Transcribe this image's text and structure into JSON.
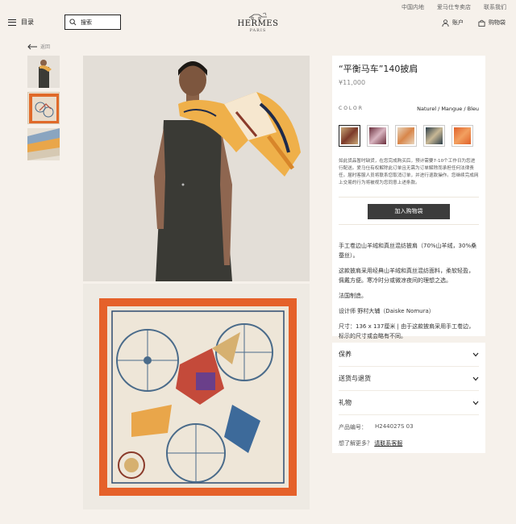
{
  "util": {
    "region": "中国内地",
    "stores": "爱马仕专卖店",
    "contact": "联系我们"
  },
  "header": {
    "menu_label": "目录",
    "search_placeholder": "搜索",
    "logo_brand": "HERMES",
    "logo_city": "PARIS",
    "account_label": "账户",
    "cart_label": "购物袋"
  },
  "back": {
    "label": "返回"
  },
  "product": {
    "title": "“平衡马车”140披肩",
    "price": "¥11,000",
    "color_label": "COLOR",
    "color_name": "Naturel / Mangue / Bleu",
    "swatches": [
      {
        "colors": [
          "#c9a878",
          "#7c3a2a"
        ]
      },
      {
        "colors": [
          "#6a2f3c",
          "#d8b4c0"
        ]
      },
      {
        "colors": [
          "#e8d6be",
          "#d8864a"
        ]
      },
      {
        "colors": [
          "#2c3e4a",
          "#c8b895"
        ]
      },
      {
        "colors": [
          "#e0612a",
          "#f2a060"
        ]
      }
    ],
    "notice": "如此货品暂时缺货，在您完成购买后，预计需要7-10个工作日为您进行配送。爱马仕有权解除此订单且无需为订单解除而承担任何法律责任。届时客服人员将联系您取消订单，并进行退款操作。您继续完成网上交易的行为将被视为您同意上述条款。",
    "add_to_cart": "加入购物袋",
    "desc": [
      "手工卷边山羊绒和真丝混纺披肩（70%山羊绒，30%桑蚕丝）。",
      "这款披肩采用经典山羊绒和真丝混纺面料，柔软轻盈，佩戴方便。寒冷时分或微凉夜间的理想之选。",
      "法国制造。",
      "设计师 野村大辅（Daiske Nomura）",
      "尺寸：136 x 137厘米 | 由于这款披肩采用手工卷边，标示的尺寸或会略有不同。"
    ]
  },
  "info": {
    "accordions": [
      "保养",
      "送货与退货",
      "礼物"
    ],
    "code_label": "产品编号：",
    "code_value": "H244027S 03",
    "more_prefix": "想了解更多？",
    "more_link": "请联系客服"
  }
}
